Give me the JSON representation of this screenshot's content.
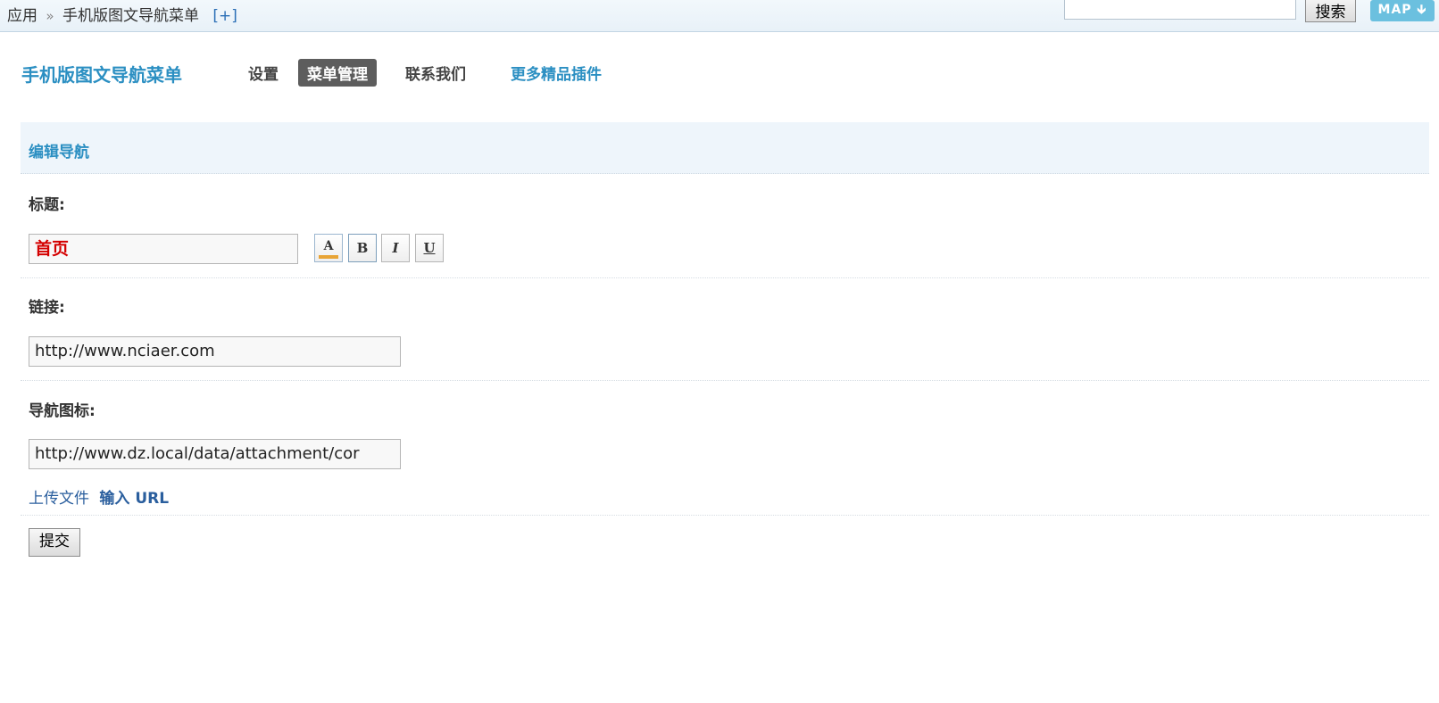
{
  "breadcrumb": {
    "root": "应用",
    "separator": "»",
    "current": "手机版图文导航菜单",
    "add_label": "[+]"
  },
  "search": {
    "value": "",
    "button_label": "搜索"
  },
  "map_button": {
    "label": "MAP",
    "icon": "arrow-down-icon"
  },
  "plugin": {
    "title": "手机版图文导航菜单",
    "tabs": [
      {
        "label": "设置",
        "active": false
      },
      {
        "label": "菜单管理",
        "active": true
      },
      {
        "label": "联系我们",
        "active": false
      },
      {
        "label": "更多精品插件",
        "active": false
      }
    ]
  },
  "section": {
    "title": "编辑导航"
  },
  "form": {
    "title_label": "标题:",
    "title_value": "首页",
    "title_color": "#d40000",
    "format_buttons": {
      "color": "A",
      "bold": "B",
      "italic": "I",
      "underline": "U"
    },
    "link_label": "链接:",
    "link_value": "http://www.nciaer.com",
    "icon_label": "导航图标:",
    "icon_value": "http://www.dz.local/data/attachment/cor",
    "upload_label": "上传文件",
    "url_label": "输入 URL",
    "submit_label": "提交"
  },
  "colors": {
    "accent": "#2b8fc2",
    "active_tab_bg": "#5d5d5d",
    "map_button_bg": "#6bc0df",
    "section_bg": "#eef5fb"
  }
}
